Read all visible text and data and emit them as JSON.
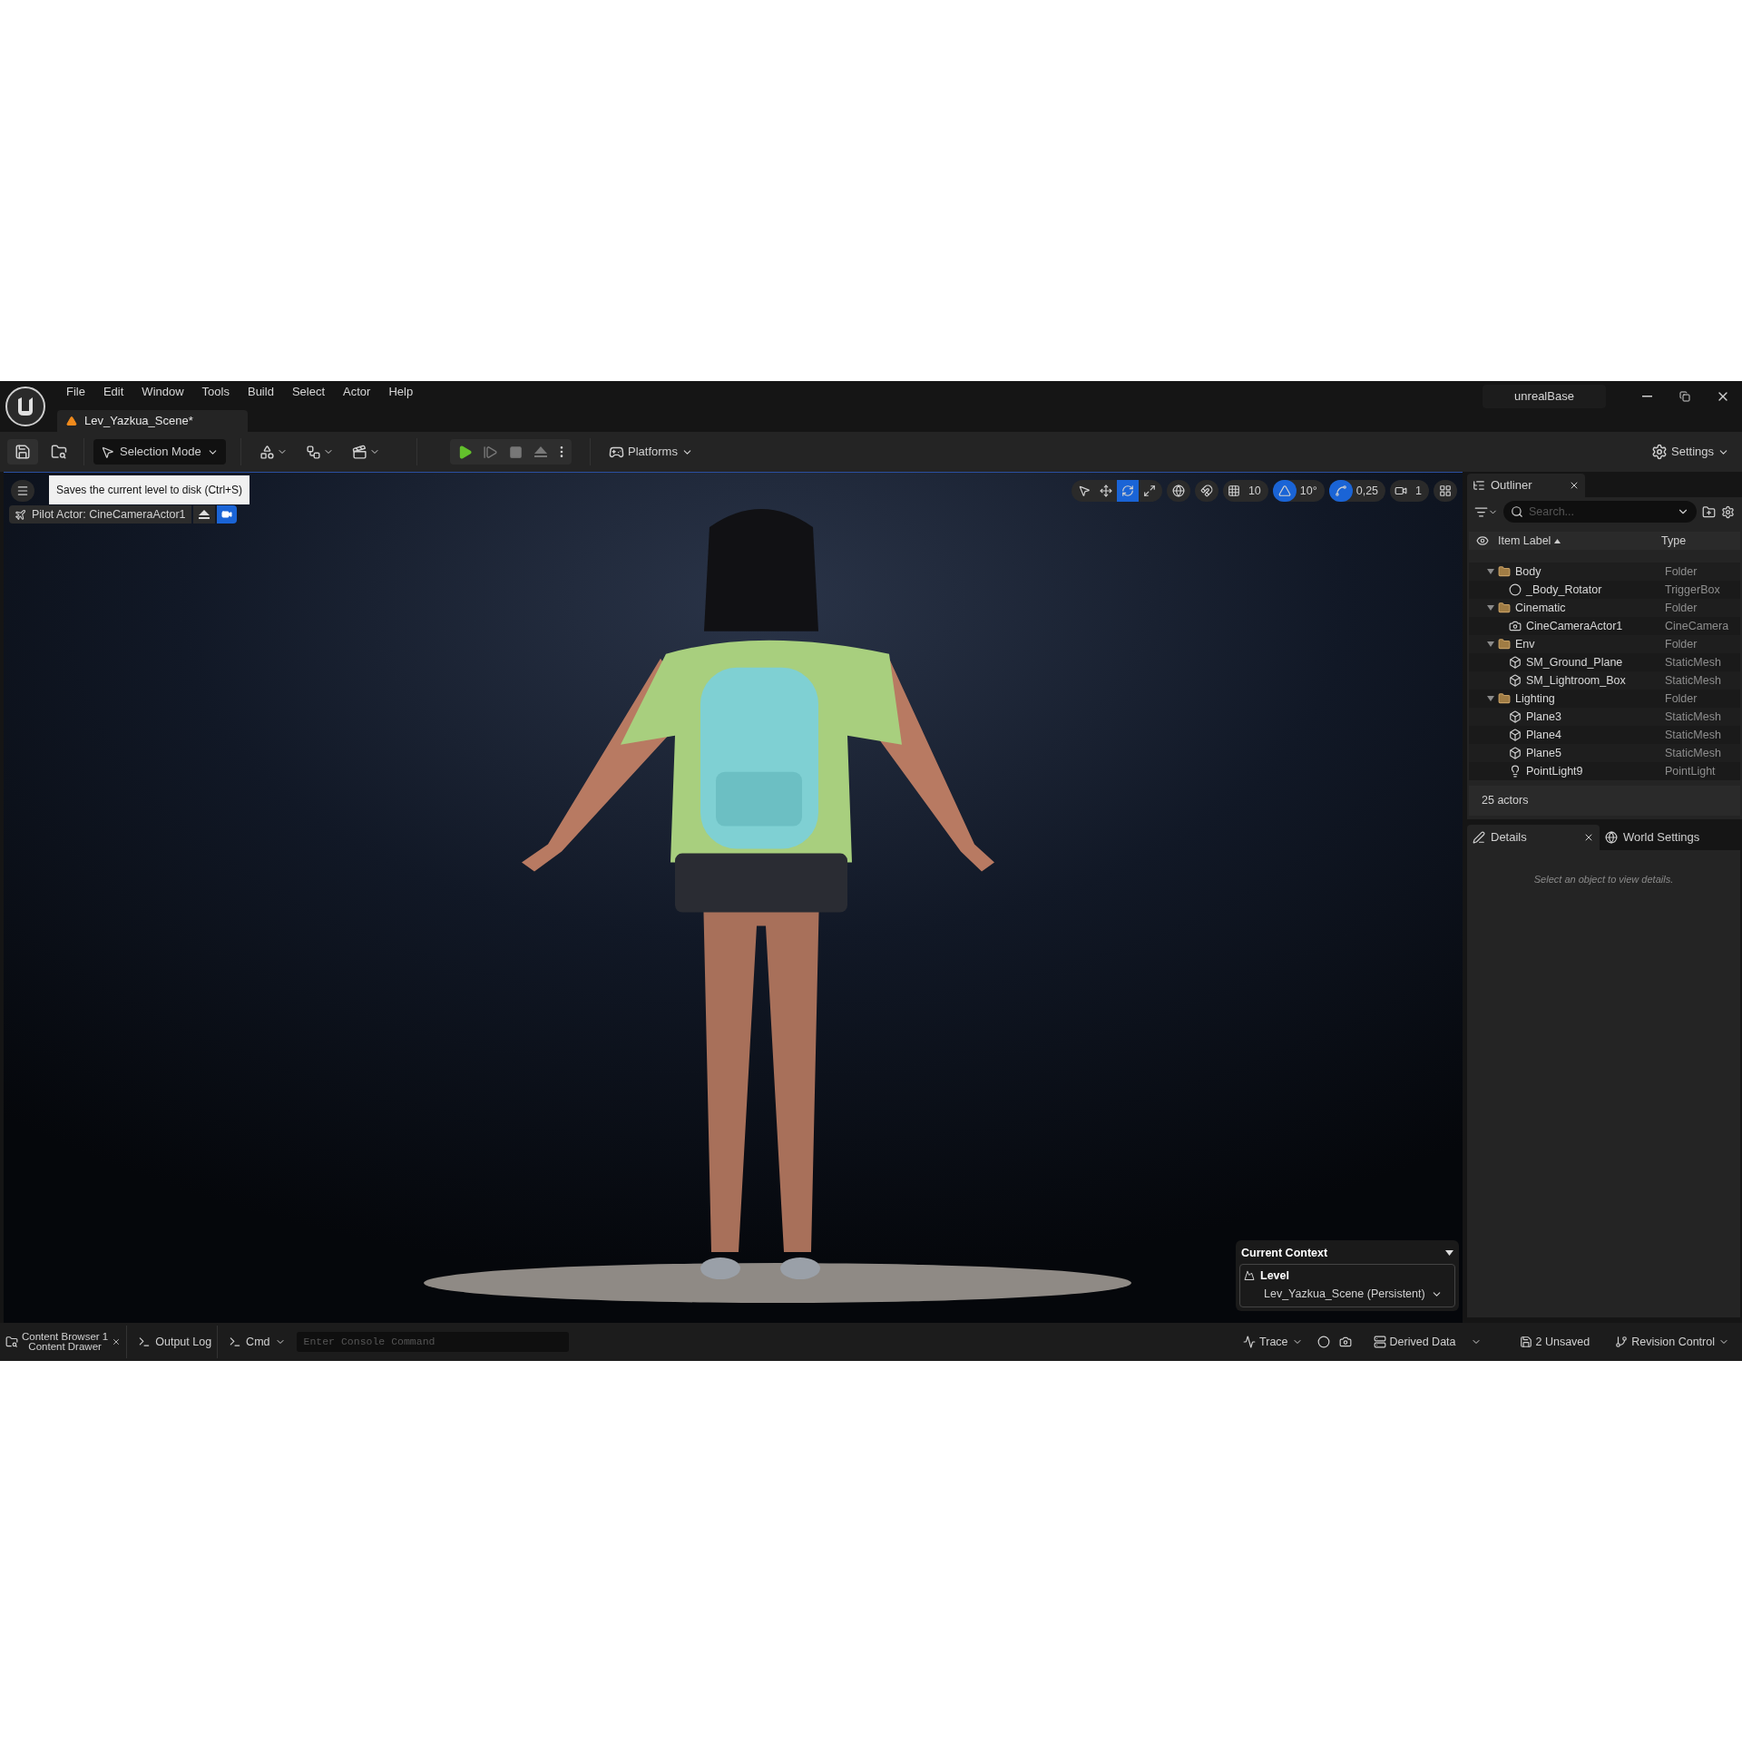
{
  "menu_bar": {
    "items": [
      "File",
      "Edit",
      "Window",
      "Tools",
      "Build",
      "Select",
      "Actor",
      "Help"
    ]
  },
  "document_tab": {
    "label": "Lev_Yazkua_Scene*"
  },
  "project_name": "unrealBase",
  "toolbar": {
    "mode_button": "Selection Mode",
    "platforms": "Platforms",
    "settings": "Settings"
  },
  "tooltip": "Saves the current level to disk (Ctrl+S)",
  "viewport": {
    "pilot_actor": "Pilot Actor: CineCameraActor1",
    "transform_tools": [
      {
        "kind": "select",
        "selected": false
      },
      {
        "kind": "translate",
        "selected": false
      },
      {
        "kind": "rotate",
        "selected": true
      },
      {
        "kind": "scale",
        "selected": false
      }
    ],
    "snaps": [
      {
        "kind": "grid",
        "value": "10",
        "on": false
      },
      {
        "kind": "rotation",
        "value": "10°",
        "on": true
      },
      {
        "kind": "scale",
        "value": "0,25",
        "on": true
      },
      {
        "kind": "camera",
        "value": "1",
        "on": false
      }
    ],
    "current_context": {
      "title": "Current Context",
      "level_label": "Level",
      "level_value": "Lev_Yazkua_Scene (Persistent)"
    }
  },
  "outliner": {
    "title": "Outliner",
    "search_placeholder": "Search...",
    "columns": [
      "Item Label",
      "Type"
    ],
    "tree": [
      {
        "label": "Body",
        "type": "Folder",
        "kind": "folder",
        "expanded": true,
        "children": [
          {
            "label": "_Body_Rotator",
            "type": "TriggerBox",
            "kind": "trigger"
          }
        ]
      },
      {
        "label": "Cinematic",
        "type": "Folder",
        "kind": "folder",
        "expanded": true,
        "children": [
          {
            "label": "CineCameraActor1",
            "type": "CineCamera",
            "kind": "camera"
          }
        ]
      },
      {
        "label": "Env",
        "type": "Folder",
        "kind": "folder",
        "expanded": true,
        "children": [
          {
            "label": "SM_Ground_Plane",
            "type": "StaticMesh",
            "kind": "mesh"
          },
          {
            "label": "SM_Lightroom_Box",
            "type": "StaticMesh",
            "kind": "mesh"
          }
        ]
      },
      {
        "label": "Lighting",
        "type": "Folder",
        "kind": "folder",
        "expanded": true,
        "children": [
          {
            "label": "Plane3",
            "type": "StaticMesh",
            "kind": "mesh"
          },
          {
            "label": "Plane4",
            "type": "StaticMesh",
            "kind": "mesh"
          },
          {
            "label": "Plane5",
            "type": "StaticMesh",
            "kind": "mesh"
          },
          {
            "label": "PointLight9",
            "type": "PointLight",
            "kind": "light"
          }
        ]
      }
    ],
    "footer": "25 actors"
  },
  "details": {
    "tabs": [
      {
        "label": "Details",
        "selected": true
      },
      {
        "label": "World Settings",
        "selected": false
      }
    ],
    "empty_message": "Select an object to view details."
  },
  "status_bar": {
    "content_browser": "Content Browser 1",
    "content_drawer": "Content Drawer",
    "output_log": "Output Log",
    "cmd": "Cmd",
    "console_placeholder": "Enter Console Command",
    "trace": "Trace",
    "derived_data": "Derived Data",
    "unsaved": "2 Unsaved",
    "revision_control": "Revision Control"
  }
}
